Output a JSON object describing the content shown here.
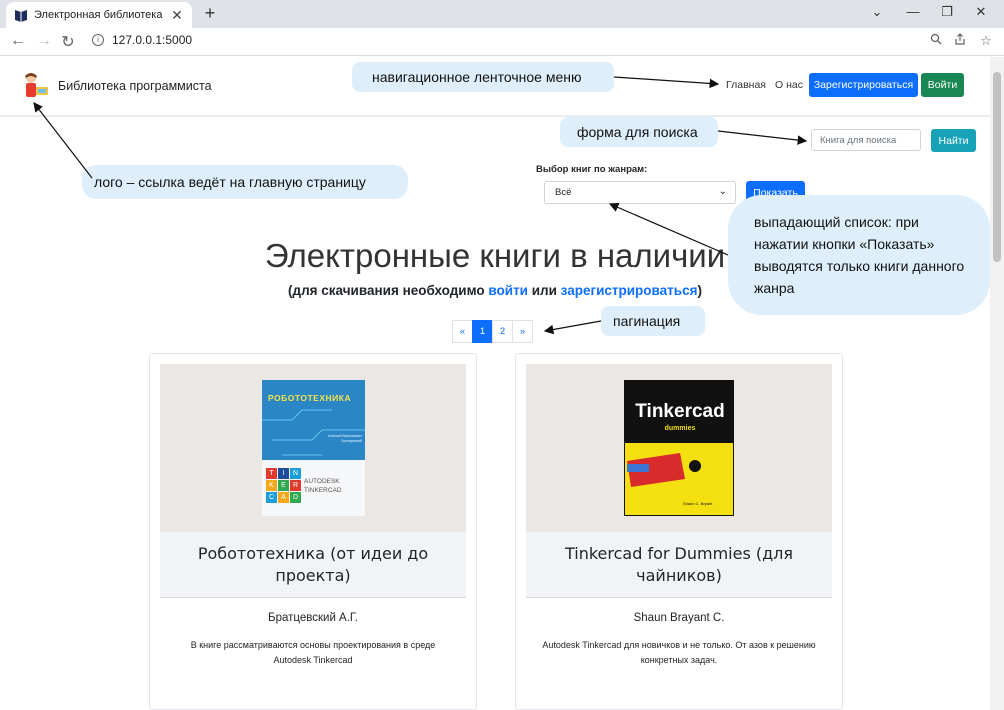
{
  "browser": {
    "tab_title": "Электронная библиотека",
    "tab_close": "✕",
    "new_tab": "+",
    "url": "127.0.0.1:5000",
    "controls": {
      "minimize": "—",
      "restore": "❐",
      "close": "✕",
      "dropdown": "⌄"
    }
  },
  "header": {
    "brand": "Библиотека программиста",
    "nav": {
      "home": "Главная",
      "about": "О нас"
    },
    "register_button": "Зарегистрироваться",
    "login_button": "Войти"
  },
  "search": {
    "placeholder": "Книга для поиска",
    "button": "Найти"
  },
  "genre": {
    "label": "Выбор книг по жанрам:",
    "selected": "Всё",
    "button": "Показать"
  },
  "main": {
    "title": "Электронные книги в наличии",
    "subtitle_pre": "(для скачивания необходимо ",
    "login_link": "войти",
    "subtitle_mid": " или ",
    "register_link": "зарегистрироваться",
    "subtitle_post": ")"
  },
  "pagination": {
    "prev": "«",
    "pages": [
      "1",
      "2"
    ],
    "next": "»",
    "active": "1"
  },
  "books": [
    {
      "title": "Робототехника (от идеи до проекта)",
      "author": "Братцевский А.Г.",
      "description": "В книге рассматриваются основы проектирования в среде Autodesk Tinkercad",
      "cover": {
        "headline": "РОБОТОТЕХНИКА",
        "author_line": "Алексей Васильевич Братцевский",
        "tin": [
          "T",
          "I",
          "N"
        ],
        "ker": [
          "K",
          "E",
          "R"
        ],
        "cad": [
          "C",
          "A",
          "D"
        ],
        "brand1": "AUTODESK",
        "brand2": "TINKERCAD"
      }
    },
    {
      "title": "Tinkercad for Dummies (для чайников)",
      "author": "Shaun Brayant C.",
      "description": "Autodesk Tinkercad для новичков и не только. От азов к решению конкретных задач.",
      "cover": {
        "headline": "Tinkercad",
        "sub": "dummies",
        "author_line": "Shaun C. Bryant"
      }
    }
  ],
  "annotations": {
    "nav_menu": "навигационное ленточное меню",
    "search_form": "форма для поиска",
    "logo": "лого – ссылка ведёт на главную страницу",
    "dropdown": "выпадающий список: при нажатии кнопки «Показать» выводятся только книги данного жанра",
    "pagination": "пагинация"
  },
  "colors": {
    "primary": "#0d6efd",
    "success": "#198754",
    "info": "#17a2b8",
    "callout": "#deeffb"
  }
}
